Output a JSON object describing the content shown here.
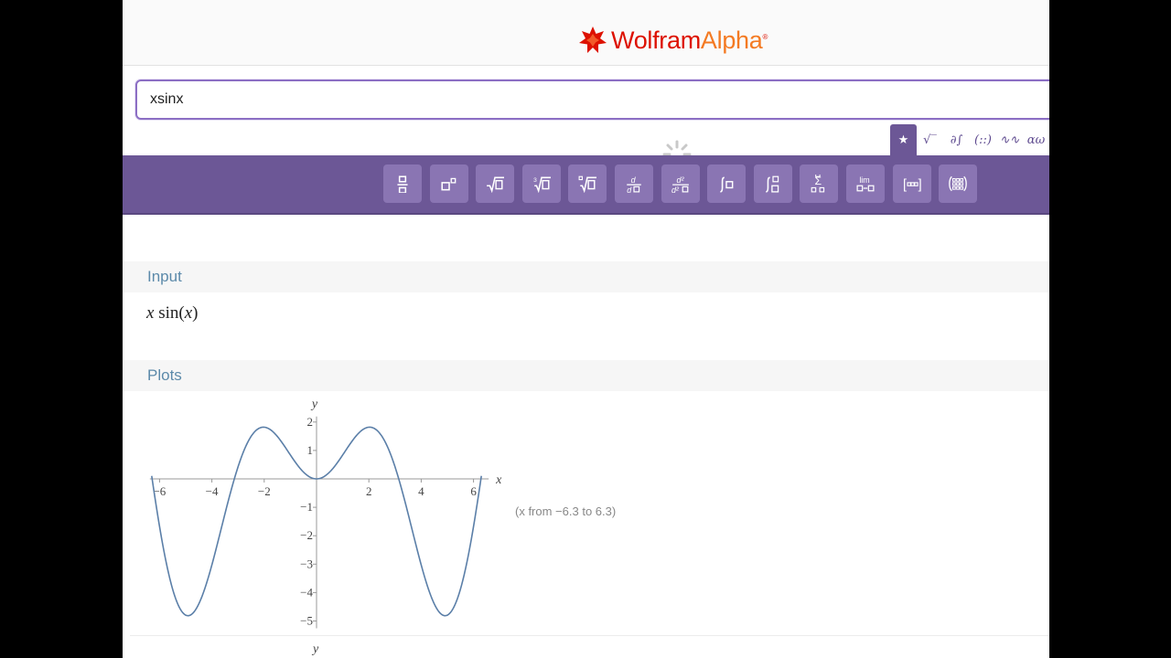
{
  "brand": {
    "wolfram": "Wolfram",
    "alpha": "Alpha",
    "mark": "®"
  },
  "search": {
    "value": "xsinx"
  },
  "mode_tabs": [
    {
      "icon": "star-icon",
      "glyph": "★"
    },
    {
      "icon": "sqrt-icon",
      "glyph": "√‾"
    },
    {
      "icon": "partial-integral-icon",
      "glyph": "∂∫"
    },
    {
      "icon": "matrix-icon",
      "glyph": "(::)"
    },
    {
      "icon": "wave-icon",
      "glyph": "∿∿"
    },
    {
      "icon": "greek-icon",
      "glyph": "αω"
    }
  ],
  "toolbar_buttons": [
    "fraction-icon",
    "superscript-icon",
    "square-root-icon",
    "cube-root-icon",
    "nth-root-icon",
    "derivative-icon",
    "second-derivative-icon",
    "integral-icon",
    "definite-integral-icon",
    "sum-icon",
    "limit-icon",
    "list-icon",
    "matrix-grid-icon"
  ],
  "pods": {
    "input_title": "Input",
    "input_expr": {
      "x": "x",
      "fn": " sin(",
      "arg": "x",
      "close": ")"
    },
    "plots_title": "Plots",
    "plot_range": "(x  from −6.3 to 6.3)"
  },
  "chart_data": {
    "type": "line",
    "function": "x sin(x)",
    "xlabel": "x",
    "ylabel": "y",
    "xlim": [
      -6.3,
      6.3
    ],
    "ylim": [
      -5,
      2
    ],
    "x_ticks": [
      -6,
      -4,
      -2,
      2,
      4,
      6
    ],
    "x_tick_labels": [
      "−6",
      "−4",
      "−2",
      "2",
      "4",
      "6"
    ],
    "y_ticks": [
      2,
      1,
      -1,
      -2,
      -3,
      -4,
      -5
    ],
    "y_tick_labels": [
      "2",
      "1",
      "−1",
      "−2",
      "−3",
      "−4",
      "−5"
    ],
    "color": "#5b7fa8"
  },
  "next_pod_ylabel": "y"
}
